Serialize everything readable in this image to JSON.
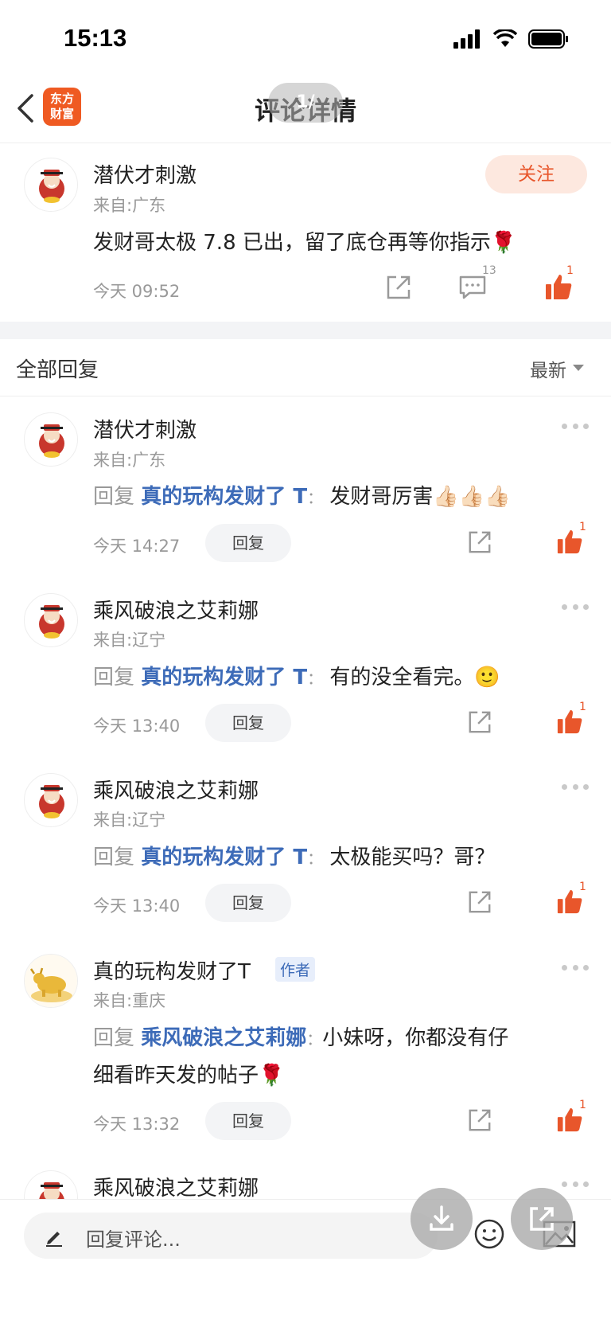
{
  "status_bar": {
    "time": "15:13"
  },
  "nav": {
    "logo_line1": "东方",
    "logo_line2": "财富",
    "title": "评论详情",
    "page_indicator": "1/"
  },
  "main_comment": {
    "user": "潜伏才刺激",
    "from": "来自:广东",
    "follow_label": "关注",
    "content": "发财哥太极 7.8 已出，留了底仓再等你指示🌹",
    "time": "今天 09:52",
    "comment_count": "13",
    "like_count": "1"
  },
  "section": {
    "title": "全部回复",
    "sort": "最新"
  },
  "reply_prefix": "回复",
  "reply_button": "回复",
  "author_tag": "作者",
  "replies": [
    {
      "user": "潜伏才刺激",
      "from": "来自:广东",
      "target": "真的玩构发财了 T",
      "text": "发财哥厉害👍🏻👍🏻👍🏻",
      "time": "今天 14:27",
      "likes": "1"
    },
    {
      "user": "乘风破浪之艾莉娜",
      "from": "来自:辽宁",
      "target": "真的玩构发财了 T",
      "text": "有的没全看完。🙂",
      "time": "今天 13:40",
      "likes": "1"
    },
    {
      "user": "乘风破浪之艾莉娜",
      "from": "来自:辽宁",
      "target": "真的玩构发财了 T",
      "text": "太极能买吗？哥？",
      "time": "今天 13:40",
      "likes": "1"
    },
    {
      "user": "真的玩构发财了T",
      "from": "来自:重庆",
      "target": "乘风破浪之艾莉娜",
      "text": "小妹呀，你都没有仔",
      "text2": "细看昨天发的帖子🌹",
      "time": "今天 13:32",
      "likes": "1"
    },
    {
      "user": "乘风破浪之艾莉娜"
    }
  ],
  "bottom": {
    "input_placeholder": "回复评论..."
  },
  "colors": {
    "accent": "#e8562b",
    "link": "#3d6bb8",
    "muted": "#999999"
  }
}
